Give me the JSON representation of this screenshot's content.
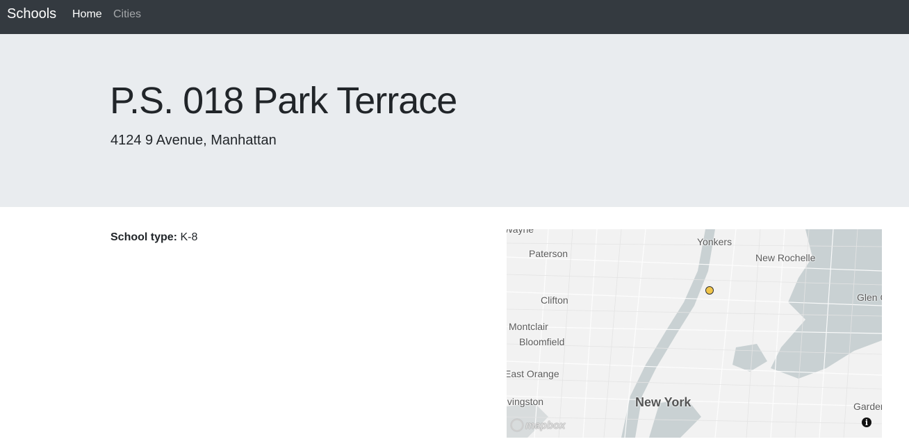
{
  "navbar": {
    "brand": "Schools",
    "links": [
      {
        "label": "Home",
        "active": true
      },
      {
        "label": "Cities",
        "active": false
      }
    ]
  },
  "hero": {
    "title": "P.S. 018 Park Terrace",
    "address": "4124 9 Avenue, Manhattan"
  },
  "details": {
    "school_type_label": "School type:",
    "school_type_value": "K-8"
  },
  "map": {
    "labels": [
      {
        "key": "wayne",
        "text": "Wayne"
      },
      {
        "key": "paterson",
        "text": "Paterson"
      },
      {
        "key": "yonkers",
        "text": "Yonkers"
      },
      {
        "key": "new_rochelle",
        "text": "New Rochelle"
      },
      {
        "key": "clifton",
        "text": "Clifton"
      },
      {
        "key": "glen_cove",
        "text": "Glen Cove"
      },
      {
        "key": "montclair",
        "text": "Montclair"
      },
      {
        "key": "bloomfield",
        "text": "Bloomfield"
      },
      {
        "key": "east_orange",
        "text": "East Orange"
      },
      {
        "key": "new_york",
        "text": "New York"
      },
      {
        "key": "livingston",
        "text": "Livingston"
      },
      {
        "key": "garden_city",
        "text": "Garden City"
      }
    ],
    "attribution_logo": "mapbox",
    "info_icon": "info-icon",
    "marker_color": "#f1c54a",
    "water_color": "#c9d1d3",
    "land_color": "#f2f2f2"
  }
}
